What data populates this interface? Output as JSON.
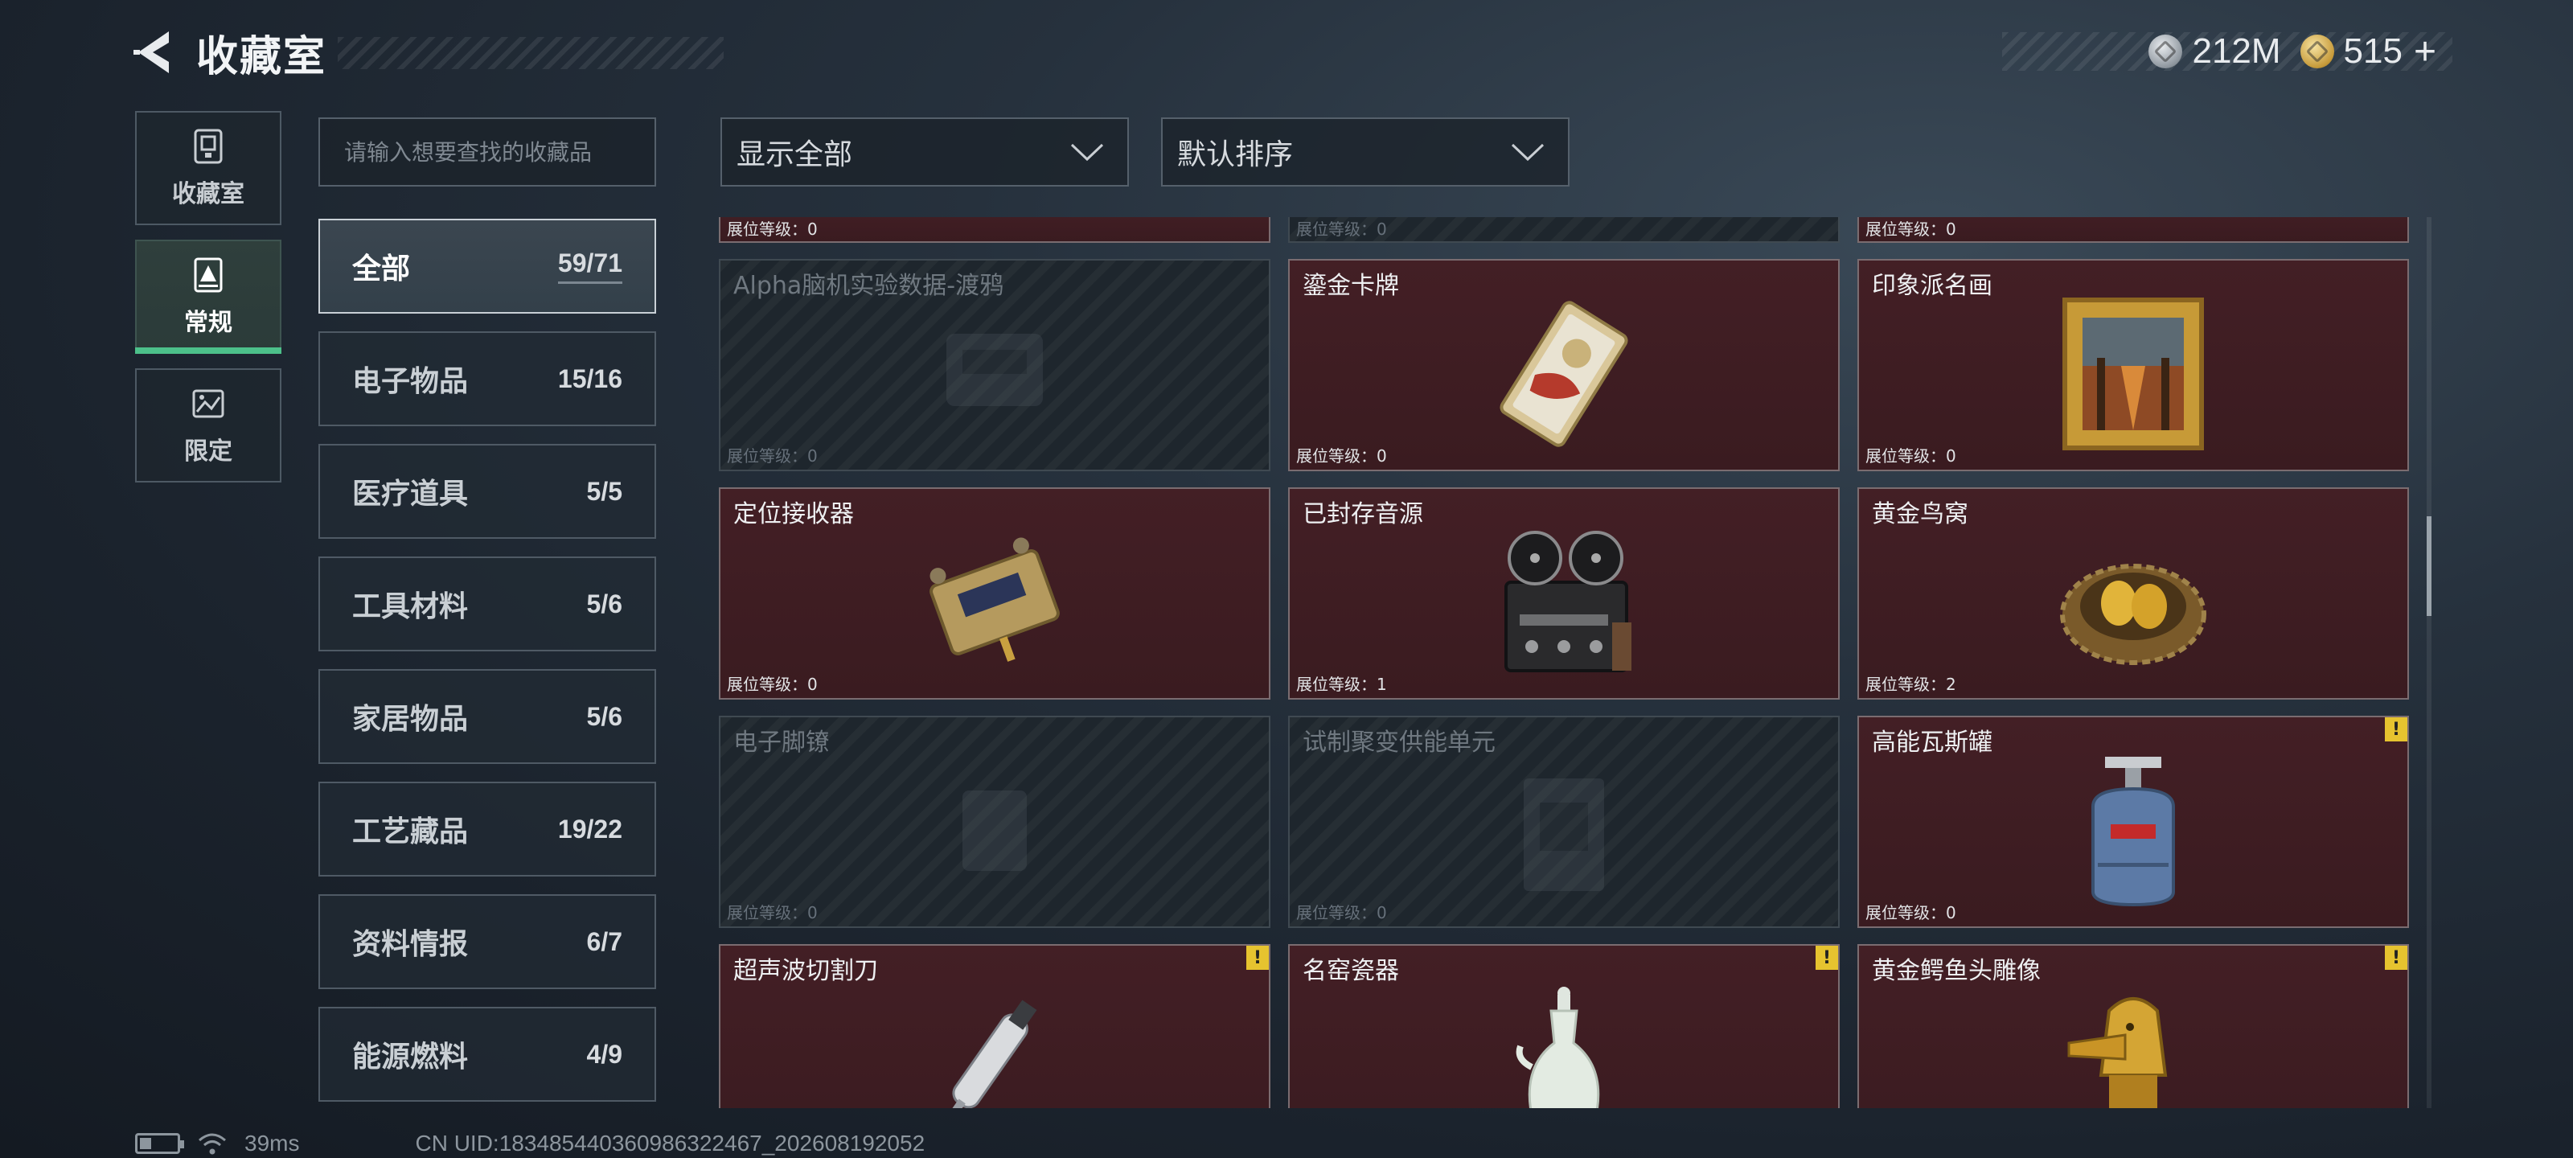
{
  "header": {
    "title": "收藏室",
    "back_icon": "back-arrow-icon"
  },
  "currency": [
    {
      "name": "silver-coin-icon",
      "value": "212M",
      "color": "#c0c6cc"
    },
    {
      "name": "gold-coin-icon",
      "value": "515",
      "suffix": "+",
      "color": "#d1a543"
    }
  ],
  "left_tabs": [
    {
      "label": "收藏室",
      "icon": "trophy-cabinet-icon",
      "active": false
    },
    {
      "label": "常规",
      "icon": "collection-icon",
      "active": true
    },
    {
      "label": "限定",
      "icon": "limited-icon",
      "active": false
    }
  ],
  "search": {
    "placeholder": "请输入想要查找的收藏品"
  },
  "categories": [
    {
      "name": "全部",
      "count": "59/71",
      "active": true
    },
    {
      "name": "电子物品",
      "count": "15/16"
    },
    {
      "name": "医疗道具",
      "count": "5/5"
    },
    {
      "name": "工具材料",
      "count": "5/6"
    },
    {
      "name": "家居物品",
      "count": "5/6"
    },
    {
      "name": "工艺藏品",
      "count": "19/22"
    },
    {
      "name": "资料情报",
      "count": "6/7"
    },
    {
      "name": "能源燃料",
      "count": "4/9"
    }
  ],
  "filters": {
    "show": "显示全部",
    "sort": "默认排序",
    "chevron_icon": "chevron-down-icon"
  },
  "level_label": "展位等级：",
  "partial_row": [
    {
      "level": "0",
      "state": "owned"
    },
    {
      "level": "0",
      "state": "locked"
    },
    {
      "level": "0",
      "state": "owned"
    }
  ],
  "items": [
    [
      {
        "name": "Alpha脑机实验数据-渡鸦",
        "level": "0",
        "state": "locked",
        "icon": "data-drive-icon",
        "warn": false
      },
      {
        "name": "鎏金卡牌",
        "level": "0",
        "state": "owned",
        "icon": "gilded-card-icon",
        "warn": false
      },
      {
        "name": "印象派名画",
        "level": "0",
        "state": "owned",
        "icon": "painting-icon",
        "warn": false
      }
    ],
    [
      {
        "name": "定位接收器",
        "level": "0",
        "state": "owned",
        "icon": "gps-receiver-icon",
        "warn": false
      },
      {
        "name": "已封存音源",
        "level": "1",
        "state": "owned",
        "icon": "tape-recorder-icon",
        "warn": false
      },
      {
        "name": "黄金鸟窝",
        "level": "2",
        "state": "owned",
        "icon": "golden-nest-icon",
        "warn": false
      }
    ],
    [
      {
        "name": "电子脚镣",
        "level": "0",
        "state": "locked",
        "icon": "ankle-monitor-icon",
        "warn": false
      },
      {
        "name": "试制聚变供能单元",
        "level": "0",
        "state": "locked",
        "icon": "fusion-unit-icon",
        "warn": false
      },
      {
        "name": "高能瓦斯罐",
        "level": "0",
        "state": "owned",
        "icon": "gas-canister-icon",
        "warn": true
      }
    ],
    [
      {
        "name": "超声波切割刀",
        "level": "",
        "state": "owned",
        "icon": "ultrasonic-cutter-icon",
        "warn": true
      },
      {
        "name": "名窑瓷器",
        "level": "",
        "state": "owned",
        "icon": "porcelain-vase-icon",
        "warn": true
      },
      {
        "name": "黄金鳄鱼头雕像",
        "level": "",
        "state": "owned",
        "icon": "golden-crocodile-icon",
        "warn": true
      }
    ]
  ],
  "warn_symbol": "!",
  "footer": {
    "ping": "39ms",
    "uid": "CN UID:18348544036098632246​7_202608192052"
  }
}
